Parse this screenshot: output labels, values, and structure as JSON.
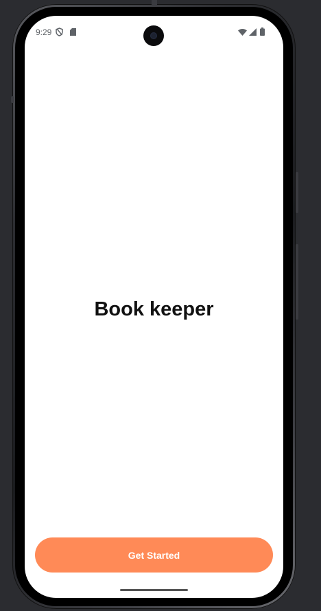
{
  "status_bar": {
    "time": "9:29",
    "left_icons": [
      "shield-icon",
      "sd-card-icon"
    ],
    "right_icons": [
      "wifi-icon",
      "signal-icon",
      "battery-icon"
    ]
  },
  "main": {
    "app_title": "Book keeper"
  },
  "actions": {
    "get_started_label": "Get Started"
  },
  "colors": {
    "accent": "#ff8a57",
    "background": "#ffffff",
    "title_text": "#111111",
    "backdrop": "#2b2c30"
  }
}
